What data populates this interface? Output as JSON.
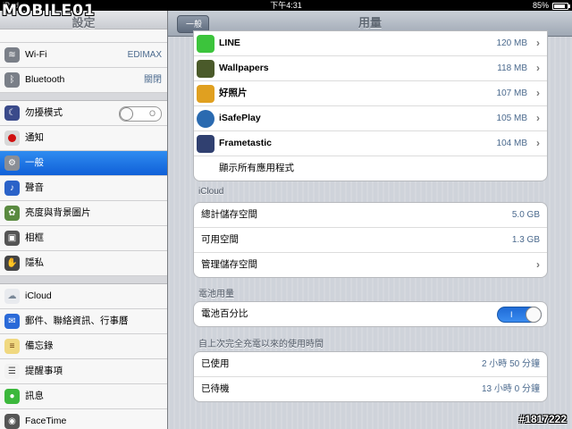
{
  "status_bar": {
    "device": "iPad",
    "time": "下午4:31",
    "battery": "85%"
  },
  "watermark": {
    "logo": "MOBILE01",
    "image_id": "#1817222"
  },
  "sidebar": {
    "title": "設定",
    "items": [
      {
        "label": "Wi-Fi",
        "value": "EDIMAX",
        "icon": "wifi-icon"
      },
      {
        "label": "Bluetooth",
        "value": "關閉",
        "icon": "bluetooth-icon"
      },
      {
        "label": "勿擾模式",
        "icon": "moon-icon",
        "toggle": "off"
      },
      {
        "label": "通知",
        "icon": "notification-icon"
      },
      {
        "label": "一般",
        "icon": "gear-icon",
        "selected": true
      },
      {
        "label": "聲音",
        "icon": "speaker-icon"
      },
      {
        "label": "亮度與背景圖片",
        "icon": "brightness-icon"
      },
      {
        "label": "相框",
        "icon": "picture-frame-icon"
      },
      {
        "label": "隱私",
        "icon": "hand-icon"
      },
      {
        "label": "iCloud",
        "icon": "cloud-icon"
      },
      {
        "label": "郵件、聯絡資訊、行事曆",
        "icon": "mail-icon"
      },
      {
        "label": "備忘錄",
        "icon": "notes-icon"
      },
      {
        "label": "提醒事項",
        "icon": "reminders-icon"
      },
      {
        "label": "訊息",
        "icon": "messages-icon"
      },
      {
        "label": "FaceTime",
        "icon": "facetime-icon"
      }
    ]
  },
  "main": {
    "title": "用量",
    "back_label": "一般",
    "apps": [
      {
        "name": "LINE",
        "size": "120 MB",
        "icon": "line-app-icon",
        "color": "#3cc43c"
      },
      {
        "name": "Wallpapers",
        "size": "118 MB",
        "icon": "wallpapers-app-icon",
        "color": "#4a5a2a"
      },
      {
        "name": "好照片",
        "size": "107 MB",
        "icon": "photo-app-icon",
        "color": "#e0a020"
      },
      {
        "name": "iSafePlay",
        "size": "105 MB",
        "icon": "isafeplay-app-icon",
        "color": "#2a6ab0"
      },
      {
        "name": "Frametastic",
        "size": "104 MB",
        "icon": "frametastic-app-icon",
        "color": "#304070"
      }
    ],
    "show_all": "顯示所有應用程式",
    "icloud": {
      "title": "iCloud",
      "total_label": "總計儲存空間",
      "total_value": "5.0 GB",
      "available_label": "可用空間",
      "available_value": "1.3 GB",
      "manage_label": "管理儲存空間"
    },
    "battery": {
      "title": "電池用量",
      "percent_label": "電池百分比",
      "switch_label": "I"
    },
    "since_charge": {
      "title": "自上次完全充電以來的使用時間",
      "usage_label": "已使用",
      "usage_value": "2 小時 50 分鐘",
      "standby_label": "已待機",
      "standby_value": "13 小時 0 分鐘"
    }
  }
}
